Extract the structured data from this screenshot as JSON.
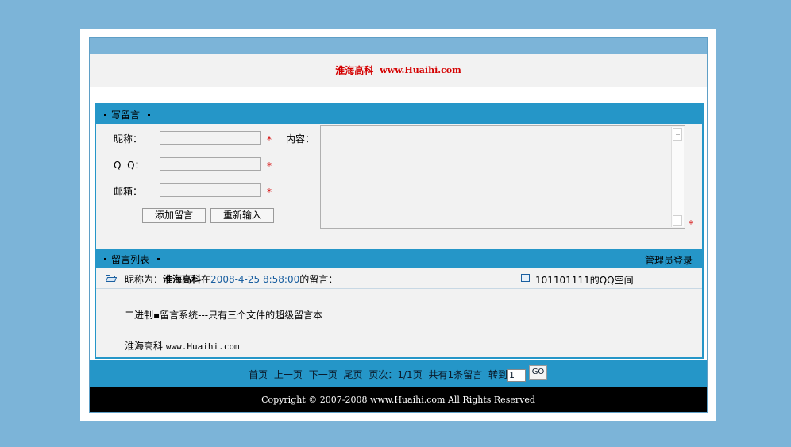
{
  "header": {
    "site_name": "淮海高科",
    "site_url": "www.Huaihi.com"
  },
  "write": {
    "section_title": "写留言",
    "nickname_label": "昵称：",
    "qq_label": "Q  Q：",
    "email_label": "邮箱：",
    "content_label": "内容：",
    "required_mark": "*",
    "add_button": "添加留言",
    "reset_button": "重新输入"
  },
  "list": {
    "section_title": "留言列表",
    "admin_login": "管理员登录",
    "messages": [
      {
        "nick_prefix": "昵称为：",
        "nick": "淮海高科",
        "at": "在",
        "date": "2008-4-25 8:58:00",
        "suffix": "的留言：",
        "qq_space": "101101111的QQ空间",
        "body_line1": "二进制▪留言系统---只有三个文件的超级留言本",
        "body_line2_text": "淮海高科",
        "body_line2_url": "www.Huaihi.com"
      }
    ]
  },
  "pager": {
    "first": "首页",
    "prev": "上一页",
    "next": "下一页",
    "last": "尾页",
    "page_info": "页次：1/1页",
    "total": "共有1条留言",
    "goto_label": "转到",
    "goto_value": "1",
    "page_unit": "页",
    "go_button": "GO"
  },
  "footer": {
    "copyright": "Copyright © 2007-2008 www.Huaihi.com All Rights Reserved"
  },
  "colors": {
    "background": "#7cb4d8",
    "bar": "#2596c8",
    "title_red": "#d40000",
    "date_blue": "#1a5fa0"
  }
}
